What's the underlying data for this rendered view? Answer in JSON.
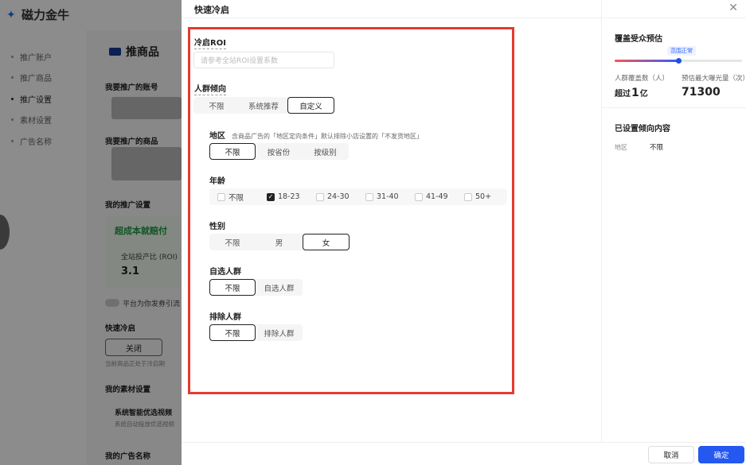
{
  "app": {
    "name": "磁力金牛"
  },
  "nav": {
    "items": [
      "推广账户",
      "推广商品",
      "推广设置",
      "素材设置",
      "广告名称"
    ]
  },
  "bg": {
    "page_title": "推商品",
    "label_account": "我要推广的账号",
    "label_product": "我要推广的商品",
    "label_settings": "我的推广设置",
    "green_title": "超成本就赔付",
    "roi_label": "全站投产比 (ROI)",
    "roi_value": "3.1",
    "toggle_label": "平台为你发券引流",
    "quick_label": "快速冷启",
    "close_btn": "关闭",
    "quick_hint": "当前商品正处于冷启期",
    "material_label": "我的素材设置",
    "material_title": "系统智能优选视频",
    "material_sub": "系统自动投放优选视频",
    "ad_name_label": "我的广告名称"
  },
  "drawer": {
    "title": "快速冷启",
    "roi": {
      "label": "冷启ROI",
      "placeholder": "请参考全站ROI设置系数"
    },
    "crowd": {
      "label": "人群倾向",
      "options": [
        "不限",
        "系统推荐",
        "自定义"
      ],
      "selected": "自定义"
    },
    "region": {
      "label": "地区",
      "hint": "含商品广告的「地区定向条件」默认排除小店设置的「不发货地区」",
      "options": [
        "不限",
        "按省份",
        "按级别"
      ],
      "selected": "不限"
    },
    "age": {
      "label": "年龄",
      "options": [
        "不限",
        "18-23",
        "24-30",
        "31-40",
        "41-49",
        "50+"
      ],
      "checked": [
        "18-23"
      ]
    },
    "gender": {
      "label": "性别",
      "options": [
        "不限",
        "男",
        "女"
      ],
      "selected": "女"
    },
    "custom_crowd": {
      "label": "自选人群",
      "options": [
        "不限",
        "自选人群"
      ],
      "selected": "不限"
    },
    "exclude_crowd": {
      "label": "排除人群",
      "options": [
        "不限",
        "排除人群"
      ],
      "selected": "不限"
    }
  },
  "estimate": {
    "title": "覆盖受众预估",
    "range_tag": "范围正常",
    "slider_value": 0.5,
    "coverage_label": "人群覆盖数（人）",
    "coverage_prefix": "超过",
    "coverage_value": "1",
    "coverage_unit": "亿",
    "exposure_label": "预估最大曝光量（次）",
    "exposure_value": "71300",
    "set_title": "已设置倾向内容",
    "set_key": "地区",
    "set_value": "不限"
  },
  "footer": {
    "cancel": "取消",
    "ok": "确定"
  },
  "colors": {
    "accent": "#2458f0",
    "highlight": "#e63a2e",
    "brand": "#1a73e8"
  }
}
